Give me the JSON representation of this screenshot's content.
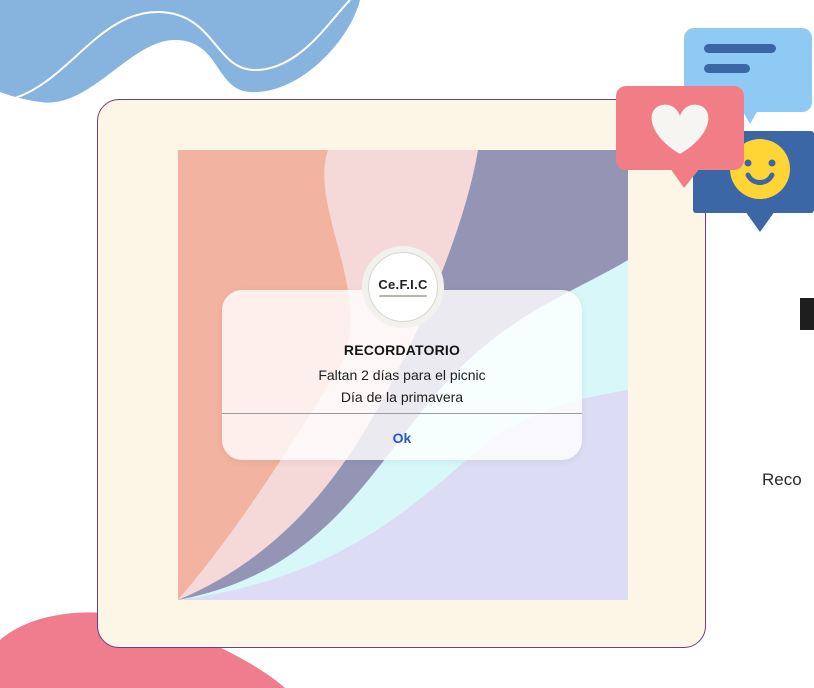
{
  "dialog": {
    "logo_text": "Ce.F.I.C",
    "title": "RECORDATORIO",
    "line1": "Faltan 2 días para el picnic",
    "line2": "Día de la primavera",
    "ok_label": "Ok"
  },
  "side_text": "Reco",
  "colors": {
    "frame_border": "#6a3f86",
    "frame_fill": "#fdf5e5",
    "ok_text": "#2a55c9",
    "deco_blue": "#86b4df",
    "deco_pink": "#f07d8d",
    "bubble_light_blue": "#8fcaf5",
    "bubble_dark_blue": "#3b67a7",
    "bubble_pink": "#f17e87",
    "smiley_yellow": "#ffd435"
  },
  "icons": [
    "message-bubble-icon",
    "heart-bubble-icon",
    "smiley-bubble-icon"
  ]
}
